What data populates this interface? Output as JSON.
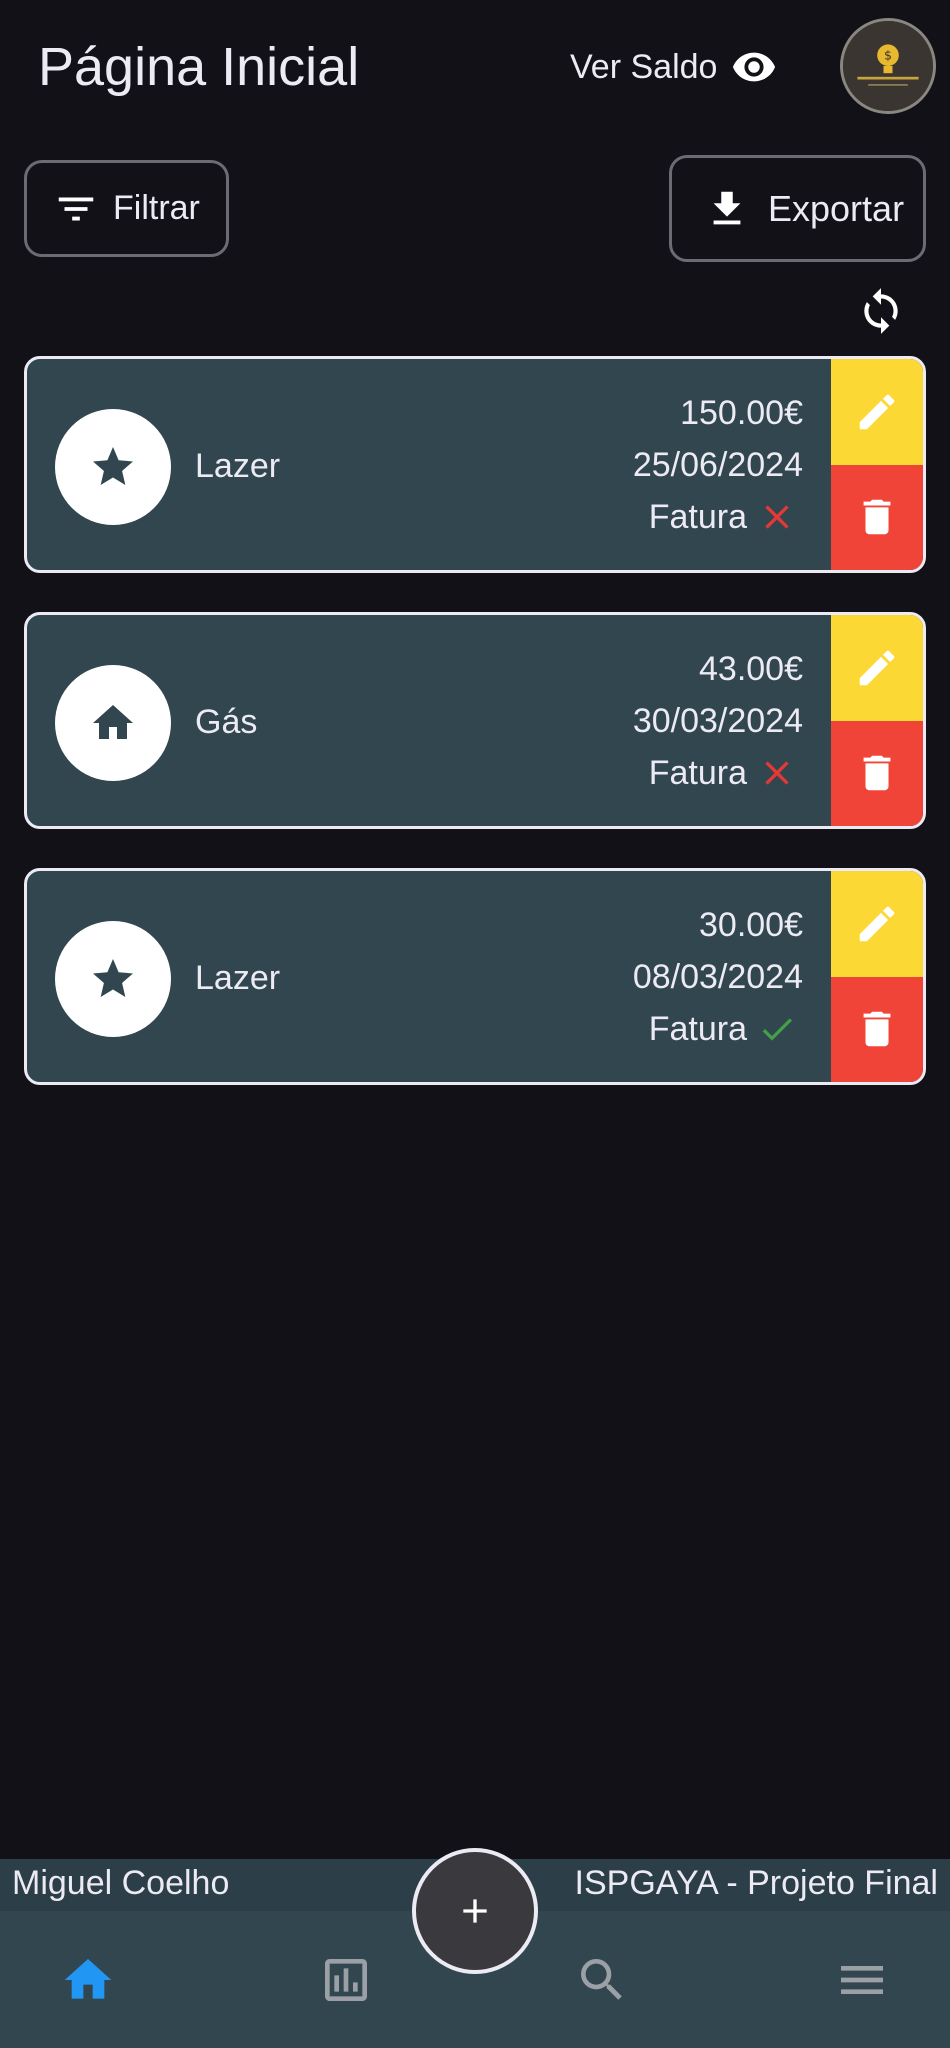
{
  "header": {
    "title": "Página Inicial",
    "ver_saldo_label": "Ver Saldo"
  },
  "toolbar": {
    "filter_label": "Filtrar",
    "export_label": "Exportar"
  },
  "colors": {
    "background": "#131118",
    "card": "#324650",
    "edit": "#FCD835",
    "delete": "#F04438",
    "nav_active": "#2196F3",
    "fatura_missing": "#E53935",
    "fatura_ok": "#43A047"
  },
  "transactions": [
    {
      "icon": "star-icon",
      "category": "Lazer",
      "amount": "150.00€",
      "date": "25/06/2024",
      "fatura_label": "Fatura",
      "fatura_status": "missing"
    },
    {
      "icon": "home-icon",
      "category": "Gás",
      "amount": "43.00€",
      "date": "30/03/2024",
      "fatura_label": "Fatura",
      "fatura_status": "missing"
    },
    {
      "icon": "star-icon",
      "category": "Lazer",
      "amount": "30.00€",
      "date": "08/03/2024",
      "fatura_label": "Fatura",
      "fatura_status": "ok"
    }
  ],
  "footer": {
    "user_name": "Miguel Coelho",
    "project": "ISPGAYA - Projeto Final"
  },
  "bottom_nav": {
    "items": [
      "home-icon",
      "bar-chart-icon",
      "search-icon",
      "menu-icon"
    ],
    "active": "home-icon"
  }
}
